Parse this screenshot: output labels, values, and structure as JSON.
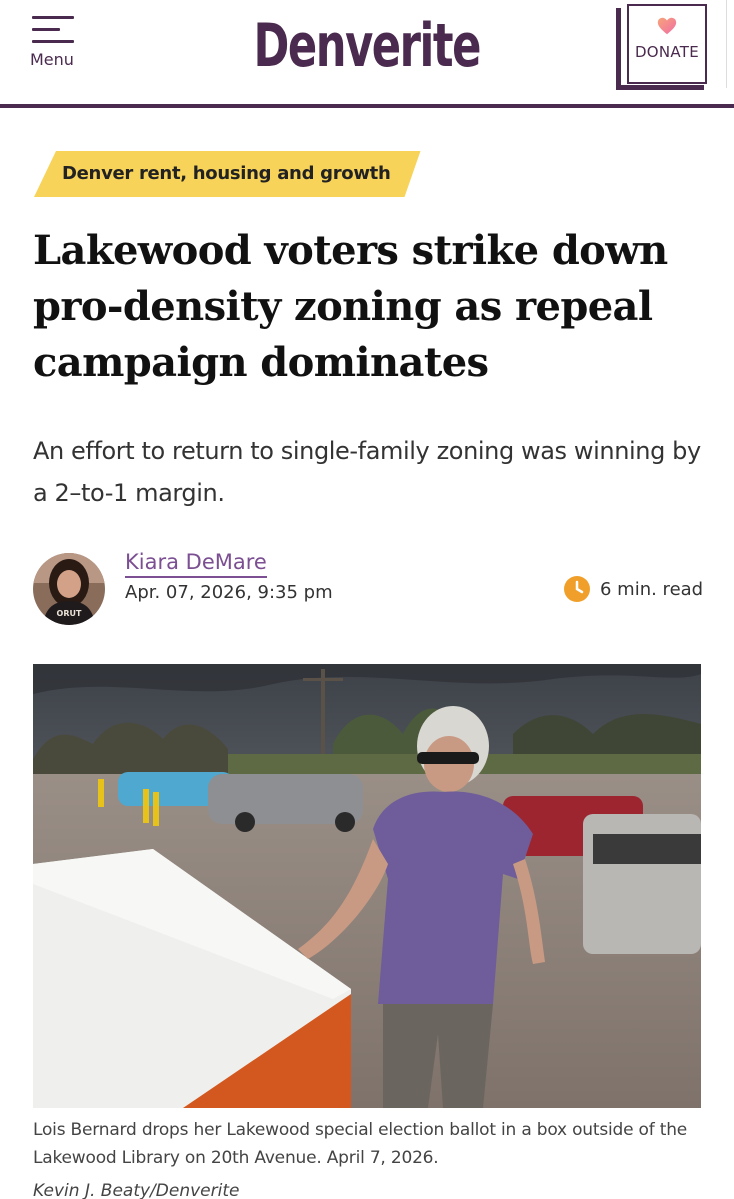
{
  "header": {
    "menu_label": "Menu",
    "logo_text": "Denverite",
    "donate_label": "DONATE"
  },
  "article": {
    "tag": "Denver rent, housing and growth",
    "headline": "Lakewood voters strike down pro-density zoning as repeal campaign dominates",
    "dek": "An effort to return to single-family zoning was winning by a 2–to-1 margin.",
    "author": "Kiara DeMare",
    "date": "Apr. 07, 2026, 9:35 pm",
    "read_time": "6 min. read",
    "caption": "Lois Bernard drops her Lakewood special election ballot in a box outside of the Lakewood Library on 20th Avenue. April 7, 2026.",
    "credit": "Kevin J. Beaty/Denverite"
  },
  "colors": {
    "brand": "#4a2a4e",
    "tag_bg": "#f8d35a",
    "author_link": "#7b4f92",
    "clock": "#f0a02a"
  },
  "icons": {
    "menu": "hamburger-icon",
    "donate": "heart-icon",
    "read_time": "clock-icon"
  }
}
